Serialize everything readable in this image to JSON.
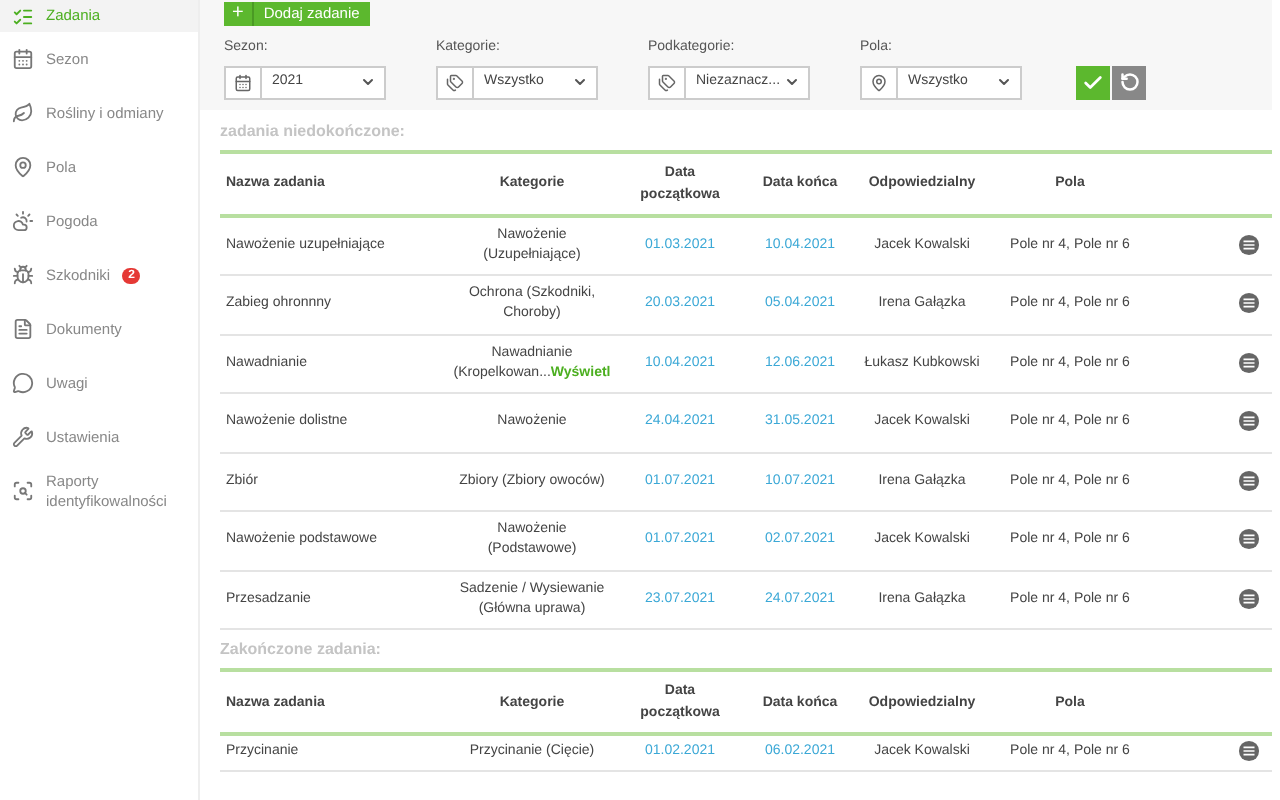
{
  "sidebar": {
    "items": [
      {
        "label": "Zadania",
        "selected": true
      },
      {
        "label": "Sezon",
        "selected": false
      },
      {
        "label": "Rośliny i odmiany",
        "selected": false
      },
      {
        "label": "Pola",
        "selected": false
      },
      {
        "label": "Pogoda",
        "selected": false
      },
      {
        "label": "Szkodniki",
        "selected": false,
        "badge": "2"
      },
      {
        "label": "Dokumenty",
        "selected": false
      },
      {
        "label": "Uwagi",
        "selected": false
      },
      {
        "label": "Ustawienia",
        "selected": false
      },
      {
        "label": "Raporty identyfikowalności",
        "selected": false
      }
    ]
  },
  "add_button": {
    "icon": "+",
    "label": "Dodaj zadanie"
  },
  "filters": [
    {
      "label": "Sezon:",
      "value": "2021"
    },
    {
      "label": "Kategorie:",
      "value": "Wszystko"
    },
    {
      "label": "Podkategorie:",
      "value": "Niezaznacz..."
    },
    {
      "label": "Pola:",
      "value": "Wszystko"
    }
  ],
  "sections": [
    {
      "title": "zadania niedokończone:",
      "columns": [
        "Nazwa zadania",
        "Kategorie",
        "Data początkowa",
        "Data końca",
        "Odpowiedzialny",
        "Pola"
      ],
      "rows": [
        {
          "name": "Nawożenie uzupełniające",
          "category": "Nawożenie (Uzupełniające)",
          "start": "01.03.2021",
          "end": "10.04.2021",
          "responsible": "Jacek Kowalski",
          "fields": "Pole nr 4, Pole nr 6"
        },
        {
          "name": "Zabieg ohronnny",
          "category": "Ochrona (Szkodniki, Choroby)",
          "start": "20.03.2021",
          "end": "05.04.2021",
          "responsible": "Irena Gałązka",
          "fields": "Pole nr 4, Pole nr 6"
        },
        {
          "name": "Nawadnianie",
          "category": "Nawadnianie (Kropelkowan...",
          "link": "Wyświetl",
          "start": "10.04.2021",
          "end": "12.06.2021",
          "responsible": "Łukasz Kubkowski",
          "fields": "Pole nr 4, Pole nr 6"
        },
        {
          "name": "Nawożenie dolistne",
          "category": "Nawożenie",
          "start": "24.04.2021",
          "end": "31.05.2021",
          "responsible": "Jacek Kowalski",
          "fields": "Pole nr 4, Pole nr 6"
        },
        {
          "name": "Zbiór",
          "category": "Zbiory (Zbiory owoców)",
          "start": "01.07.2021",
          "end": "10.07.2021",
          "responsible": "Irena Gałązka",
          "fields": "Pole nr 4, Pole nr 6"
        },
        {
          "name": "Nawożenie podstawowe",
          "category": "Nawożenie (Podstawowe)",
          "start": "01.07.2021",
          "end": "02.07.2021",
          "responsible": "Jacek Kowalski",
          "fields": "Pole nr 4, Pole nr 6"
        },
        {
          "name": "Przesadzanie",
          "category": "Sadzenie / Wysiewanie (Główna uprawa)",
          "start": "23.07.2021",
          "end": "24.07.2021",
          "responsible": "Irena Gałązka",
          "fields": "Pole nr 4, Pole nr 6"
        }
      ]
    },
    {
      "title": "Zakończone zadania:",
      "columns": [
        "Nazwa zadania",
        "Kategorie",
        "Data początkowa",
        "Data końca",
        "Odpowiedzialny",
        "Pola"
      ],
      "rows": [
        {
          "name": "Przycinanie",
          "category": "Przycinanie (Cięcie)",
          "start": "01.02.2021",
          "end": "06.02.2021",
          "responsible": "Jacek Kowalski",
          "fields": "Pole nr 4, Pole nr 6"
        }
      ]
    }
  ]
}
